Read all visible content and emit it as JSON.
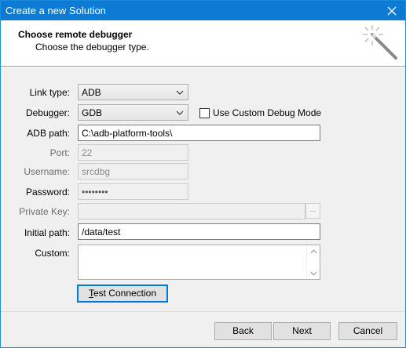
{
  "window": {
    "title": "Create a new Solution",
    "accent": "#0d7bd3"
  },
  "header": {
    "title": "Choose remote debugger",
    "subtitle": "Choose the debugger type."
  },
  "form": {
    "link_type": {
      "label": "Link type:",
      "value": "ADB"
    },
    "debugger": {
      "label": "Debugger:",
      "value": "GDB"
    },
    "custom_debug_mode": {
      "label": "Use Custom Debug Mode",
      "checked": false
    },
    "adb_path": {
      "label": "ADB path:",
      "value": "C:\\adb-platform-tools\\"
    },
    "port": {
      "label": "Port:",
      "value": "22"
    },
    "username": {
      "label": "Username:",
      "value": "srcdbg"
    },
    "password": {
      "label": "Password:",
      "value": "••••••••"
    },
    "private_key": {
      "label": "Private Key:",
      "value": "",
      "browse_label": "..."
    },
    "initial_path": {
      "label": "Initial path:",
      "value": "/data/test"
    },
    "custom": {
      "label": "Custom:",
      "value": ""
    }
  },
  "buttons": {
    "test_connection_first": "T",
    "test_connection_rest": "est Connection",
    "back": "Back",
    "next": "Next",
    "cancel": "Cancel"
  },
  "icons": {
    "close": "close-icon",
    "wizard": "magic-wand-icon",
    "dropdown": "chevron-down-icon"
  }
}
